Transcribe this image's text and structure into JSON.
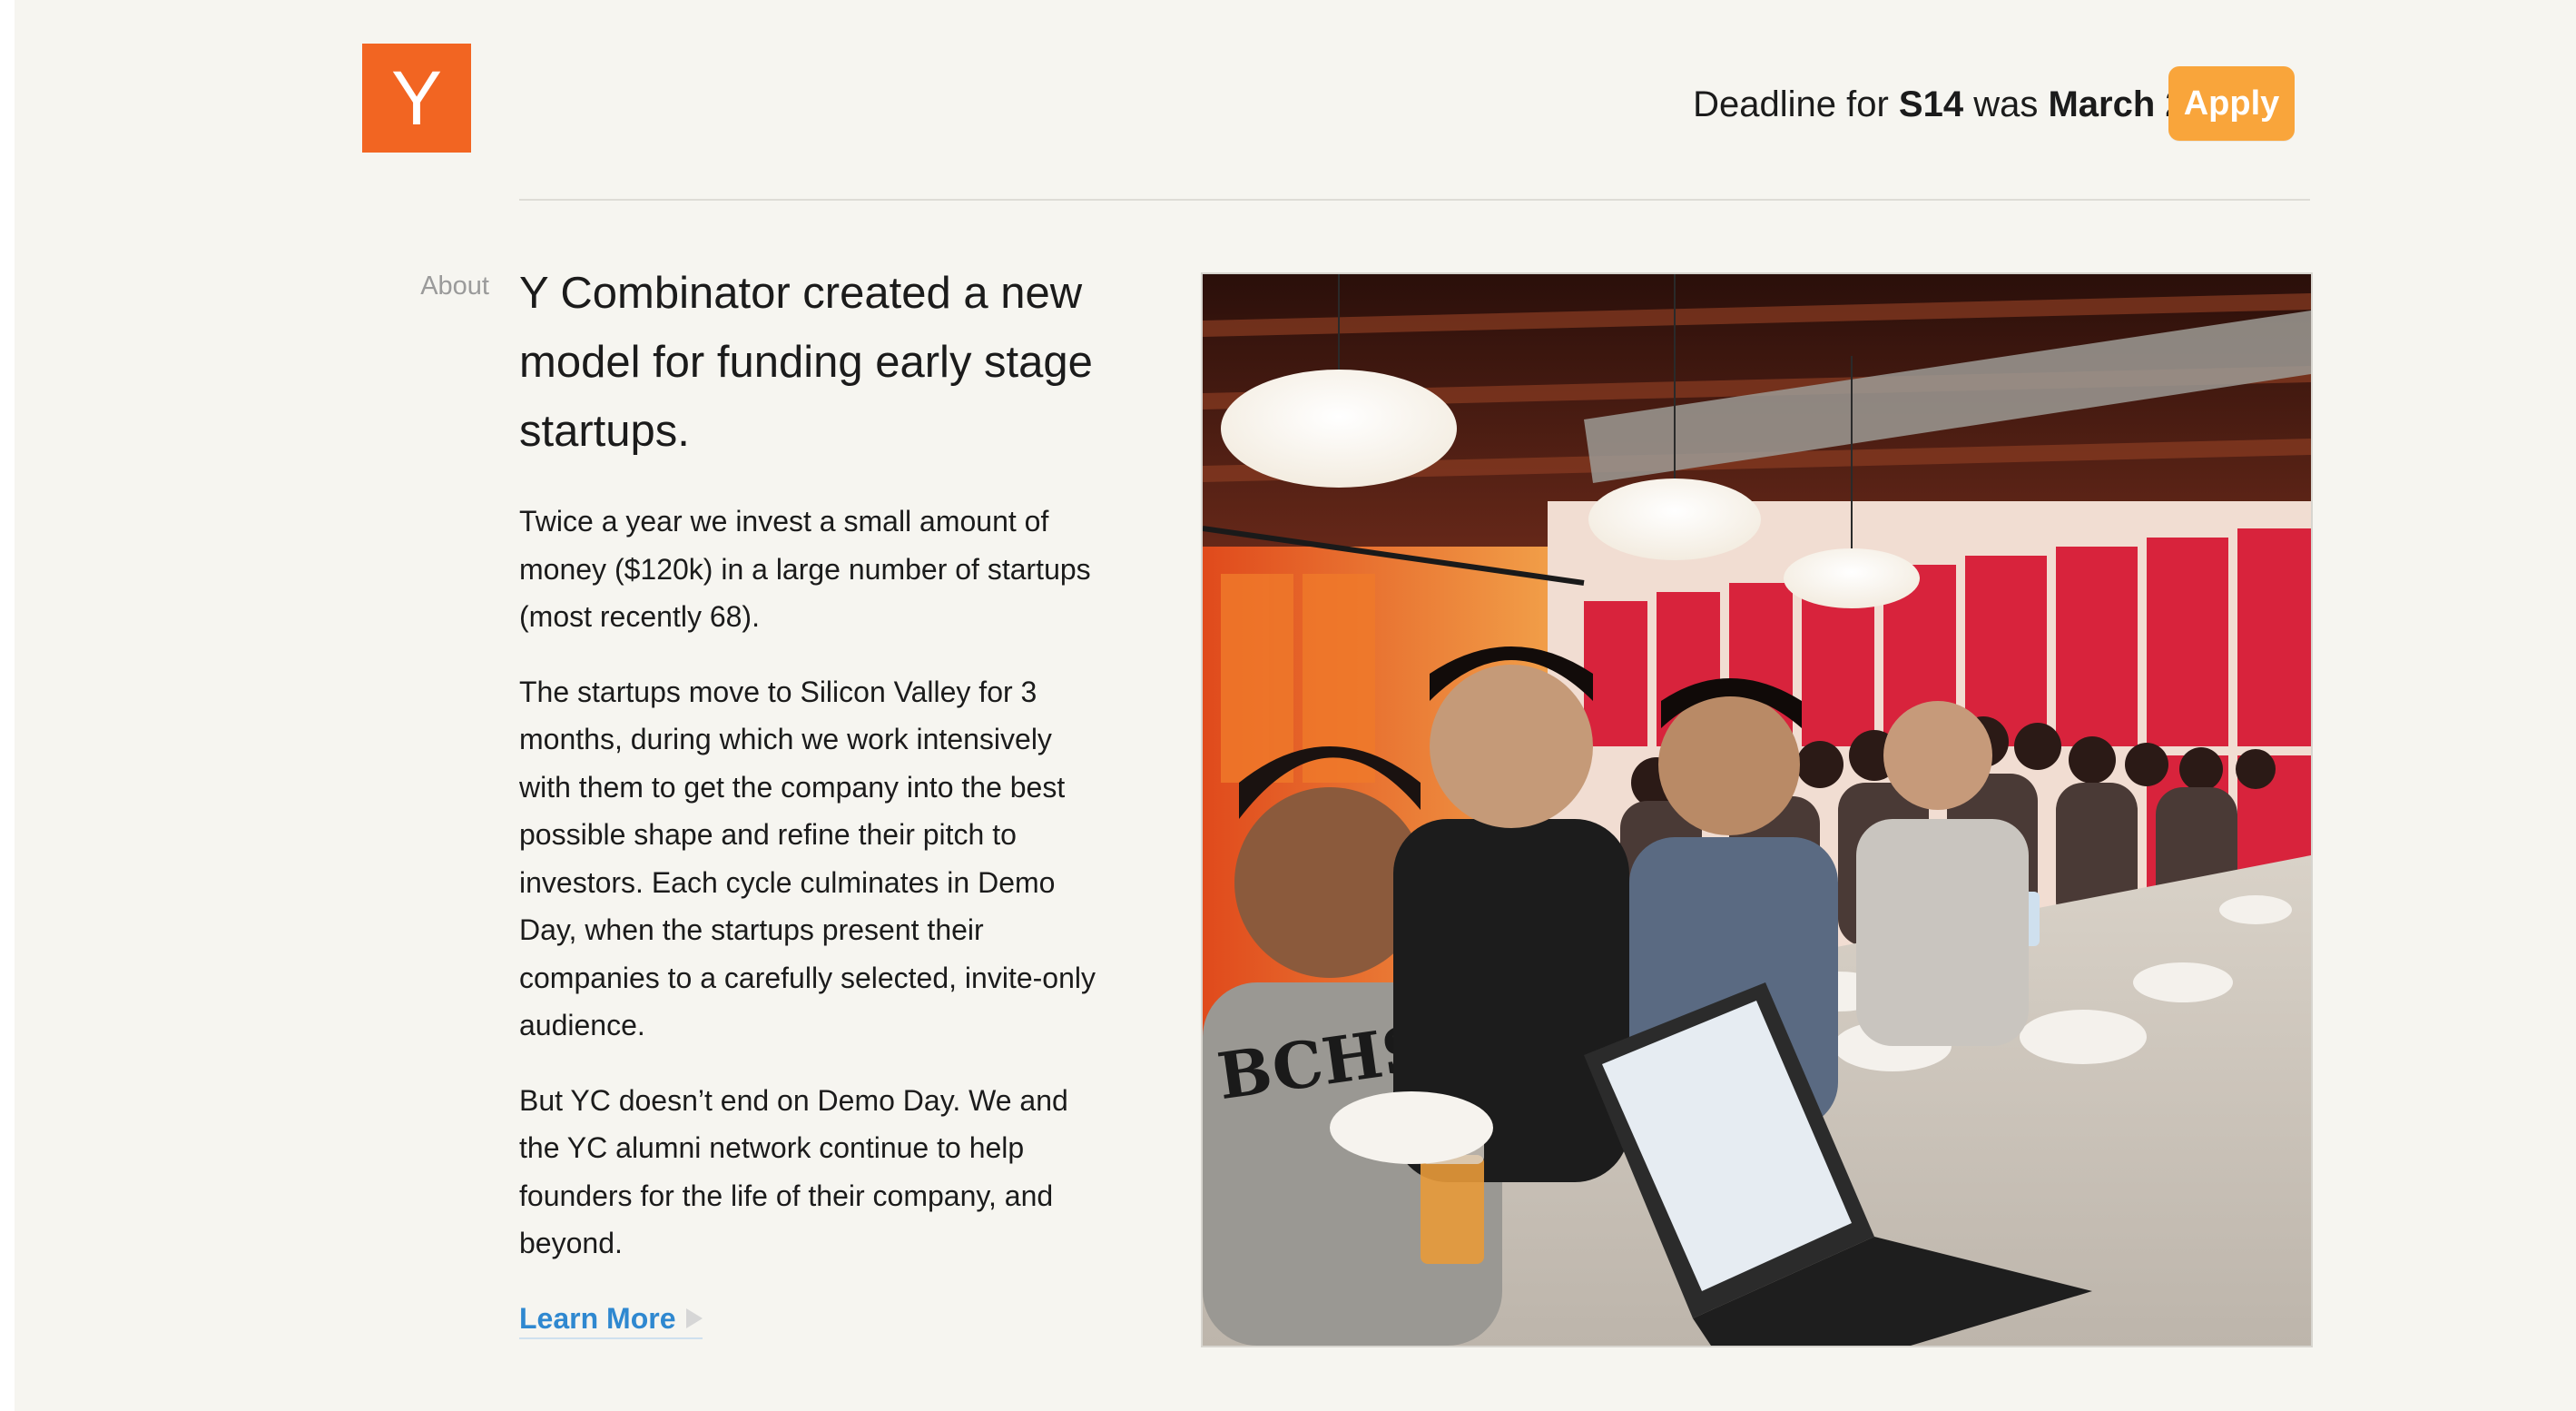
{
  "header": {
    "logo_letter": "Y",
    "deadline_prefix": "Deadline for ",
    "deadline_batch": "S14",
    "deadline_mid": " was ",
    "deadline_date": "March 28",
    "deadline_suffix": ".",
    "apply_label": "Apply"
  },
  "section": {
    "label": "About",
    "headline": "Y Combinator created a new model for funding early stage startups.",
    "paragraphs": [
      "Twice a year we invest a small amount of money ($120k) in a large number of startups (most recently 68).",
      "The startups move to Silicon Valley for 3 months, during which we work intensively with them to get the company into the best possible shape and refine their pitch to investors. Each cycle culminates in Demo Day, when the startups present their companies to a carefully selected, invite-only audience.",
      "But YC doesn’t end on Demo Day. We and the YC alumni network continue to help founders for the life of their company, and beyond."
    ],
    "learn_more_label": "Learn More",
    "photo_icon": "photo-image",
    "shirt_text": "BCHS"
  },
  "colors": {
    "page_background": "#f6f5f0",
    "logo_orange": "#f26522",
    "apply_orange": "#f9a53b",
    "link_blue": "#2f88d0"
  }
}
